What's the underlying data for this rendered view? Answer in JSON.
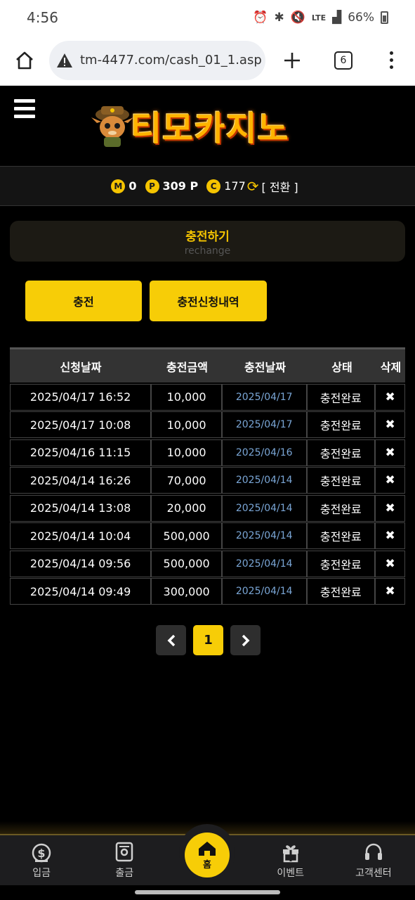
{
  "status_bar": {
    "time": "4:56",
    "battery": "66%",
    "network": "LTE"
  },
  "browser": {
    "url": "tm-4477.com/cash_01_1.asp",
    "tab_count": "6"
  },
  "site": {
    "logo_text": "티모카지노"
  },
  "points": {
    "m_label": "M",
    "m_value": "0",
    "p_label": "P",
    "p_value": "309 P",
    "c_label": "C",
    "c_value": "177",
    "convert_label": "[ 전환 ]"
  },
  "title_card": {
    "title": "충전하기",
    "subtitle": "rechange"
  },
  "buttons": {
    "charge": "충전",
    "history": "충전신청내역"
  },
  "table": {
    "headers": [
      "신청날짜",
      "충전금액",
      "충전날짜",
      "상태",
      "삭제"
    ],
    "rows": [
      {
        "request_date": "2025/04/17 16:52",
        "amount": "10,000",
        "charge_date": "2025/04/17",
        "status": "충전완료",
        "delete": "✖"
      },
      {
        "request_date": "2025/04/17 10:08",
        "amount": "10,000",
        "charge_date": "2025/04/17",
        "status": "충전완료",
        "delete": "✖"
      },
      {
        "request_date": "2025/04/16 11:15",
        "amount": "10,000",
        "charge_date": "2025/04/16",
        "status": "충전완료",
        "delete": "✖"
      },
      {
        "request_date": "2025/04/14 16:26",
        "amount": "70,000",
        "charge_date": "2025/04/14",
        "status": "충전완료",
        "delete": "✖"
      },
      {
        "request_date": "2025/04/14 13:08",
        "amount": "20,000",
        "charge_date": "2025/04/14",
        "status": "충전완료",
        "delete": "✖"
      },
      {
        "request_date": "2025/04/14 10:04",
        "amount": "500,000",
        "charge_date": "2025/04/14",
        "status": "충전완료",
        "delete": "✖"
      },
      {
        "request_date": "2025/04/14 09:56",
        "amount": "500,000",
        "charge_date": "2025/04/14",
        "status": "충전완료",
        "delete": "✖"
      },
      {
        "request_date": "2025/04/14 09:49",
        "amount": "300,000",
        "charge_date": "2025/04/14",
        "status": "충전완료",
        "delete": "✖"
      }
    ]
  },
  "pagination": {
    "prev": "‹",
    "current": "1",
    "next": "›"
  },
  "bottom_nav": {
    "deposit": "입금",
    "withdraw": "출금",
    "home": "홈",
    "event": "이벤트",
    "support": "고객센터"
  },
  "colors": {
    "accent_yellow": "#f7cd07",
    "link_blue": "#7aa6d6",
    "background": "#000000"
  }
}
